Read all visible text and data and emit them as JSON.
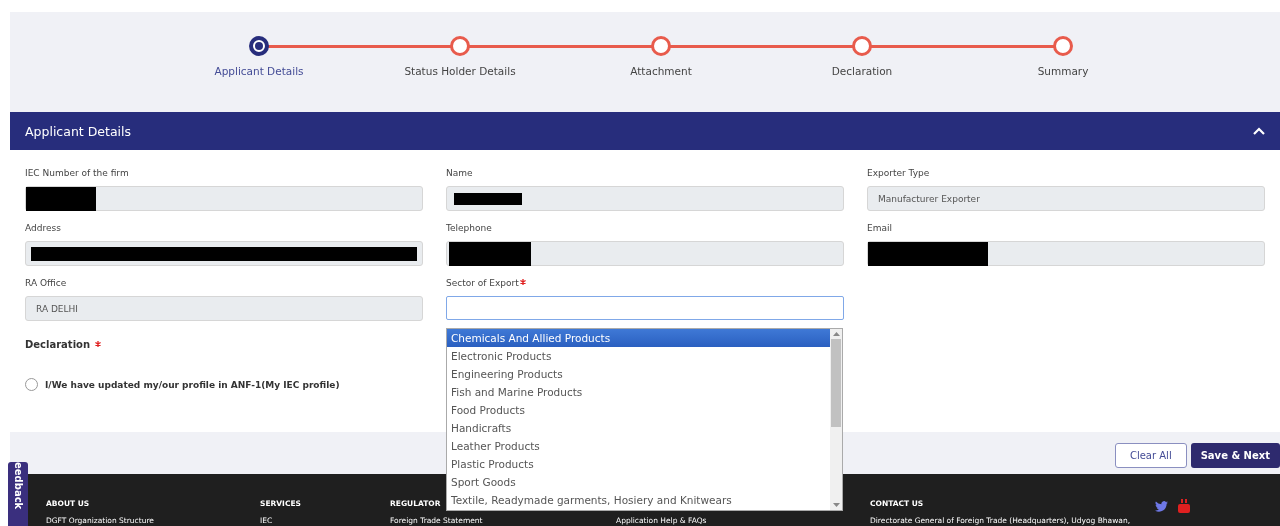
{
  "stepper": [
    {
      "label": "Applicant Details",
      "selected": true
    },
    {
      "label": "Status Holder Details",
      "selected": false
    },
    {
      "label": "Attachment",
      "selected": false
    },
    {
      "label": "Declaration",
      "selected": false
    },
    {
      "label": "Summary",
      "selected": false
    }
  ],
  "section": {
    "title": "Applicant Details",
    "expanded": true
  },
  "fields": [
    {
      "label": "IEC Number of the firm",
      "redacted": true
    },
    {
      "label": "Name",
      "redacted": true
    },
    {
      "label": "Exporter Type",
      "value": "Manufacturer Exporter",
      "redacted": false
    },
    {
      "label": "Address",
      "redacted": true
    },
    {
      "label": "Telephone",
      "redacted": true
    },
    {
      "label": "Email",
      "redacted": true
    },
    {
      "label": "RA Office",
      "value": "RA DELHI",
      "redacted": false
    }
  ],
  "sector": {
    "label": "Sector of Export",
    "required": true,
    "options": [
      {
        "label": "Chemicals And Allied Products",
        "selected": true
      },
      {
        "label": "Electronic Products",
        "selected": false
      },
      {
        "label": "Engineering Products",
        "selected": false
      },
      {
        "label": "Fish and Marine Products",
        "selected": false
      },
      {
        "label": "Food Products",
        "selected": false
      },
      {
        "label": "Handicrafts",
        "selected": false
      },
      {
        "label": "Leather Products",
        "selected": false
      },
      {
        "label": "Plastic Products",
        "selected": false
      },
      {
        "label": "Sport Goods",
        "selected": false
      },
      {
        "label": "Textile, Readymade garments, Hosiery and Knitwears",
        "selected": false
      }
    ]
  },
  "declaration": {
    "label": "Declaration",
    "required": true,
    "option": {
      "label": "I/We have updated my/our profile in ANF-1(My IEC profile)",
      "checked": false
    }
  },
  "buttons": [
    {
      "label": "Clear All",
      "kind": "outline"
    },
    {
      "label": "Save & Next",
      "kind": "primary"
    }
  ],
  "feedback_tab": "eedback",
  "footer": {
    "columns": [
      {
        "heading": "ABOUT US",
        "links": [
          "DGFT Organization Structure"
        ]
      },
      {
        "heading": "SERVICES",
        "links": [
          "IEC"
        ]
      },
      {
        "heading": "REGULATOR",
        "links": [
          "Foreign Trade Statement"
        ]
      },
      {
        "links": [
          "Application Help & FAQs"
        ]
      },
      {
        "heading": "CONTACT US",
        "links": [
          "Directorate General of Foreign Trade (Headquarters), Udyog Bhawan,"
        ]
      }
    ]
  }
}
